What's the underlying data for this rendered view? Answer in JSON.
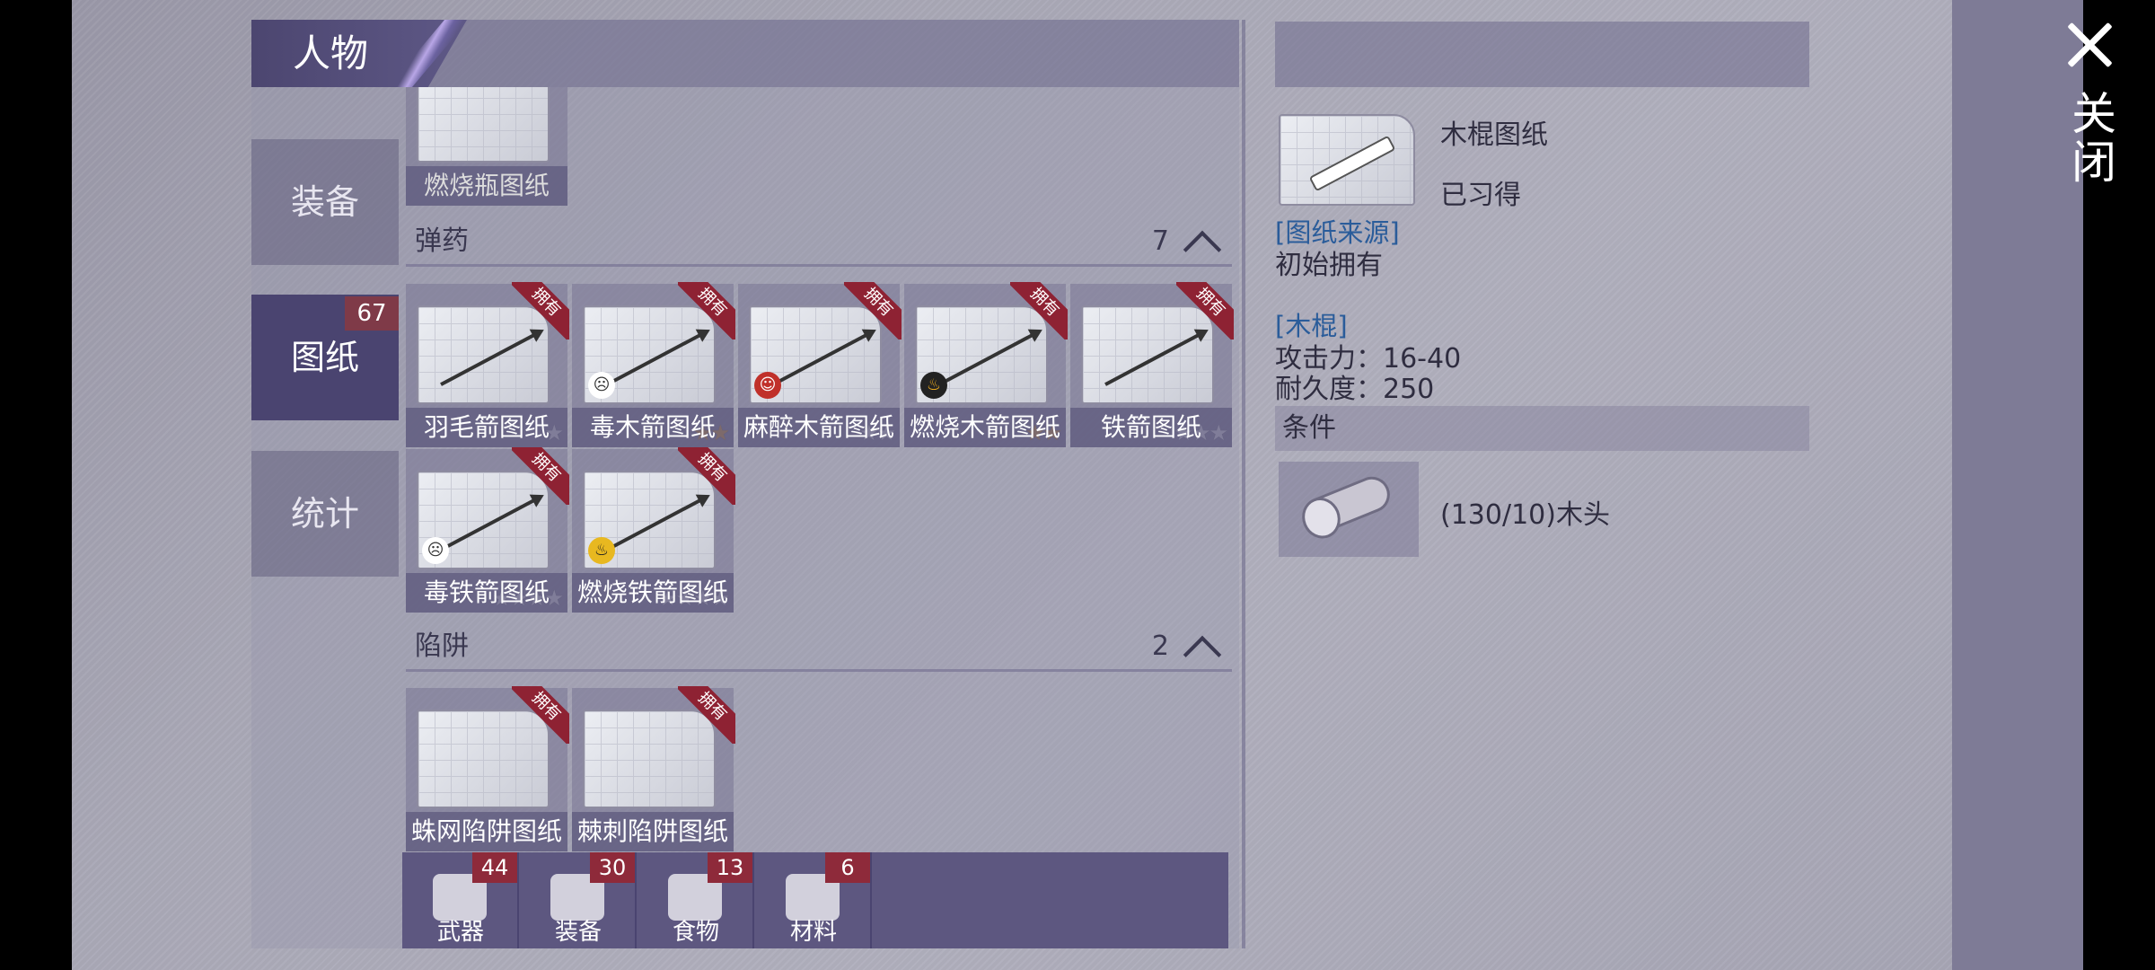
{
  "header": {
    "title": "人物"
  },
  "close": {
    "label": "关闭"
  },
  "side_tabs": [
    {
      "label": "装备"
    },
    {
      "label": "图纸",
      "badge": "67"
    },
    {
      "label": "统计"
    }
  ],
  "top_item": {
    "label": "燃烧瓶图纸"
  },
  "sections": [
    {
      "title": "弹药",
      "count": "7",
      "items": [
        {
          "label": "羽毛箭图纸",
          "owned": "拥有",
          "stars": "★"
        },
        {
          "label": "毒木箭图纸",
          "owned": "拥有",
          "stars": "★★"
        },
        {
          "label": "麻醉木箭图纸",
          "owned": "拥有",
          "stars": "★★"
        },
        {
          "label": "燃烧木箭图纸",
          "owned": "拥有",
          "stars": "★★"
        },
        {
          "label": "铁箭图纸",
          "owned": "拥有",
          "stars": "★★★"
        },
        {
          "label": "毒铁箭图纸",
          "owned": "拥有",
          "stars": "★★★★"
        },
        {
          "label": "燃烧铁箭图纸",
          "owned": "拥有",
          "stars": "★★★★"
        }
      ]
    },
    {
      "title": "陷阱",
      "count": "2",
      "items": [
        {
          "label": "蛛网陷阱图纸",
          "owned": "拥有"
        },
        {
          "label": "棘刺陷阱图纸",
          "owned": "拥有"
        }
      ]
    }
  ],
  "bottom_tabs": [
    {
      "label": "武器",
      "badge": "44"
    },
    {
      "label": "装备",
      "badge": "30"
    },
    {
      "label": "食物",
      "badge": "13"
    },
    {
      "label": "材料",
      "badge": "6"
    }
  ],
  "detail": {
    "name": "木棍图纸",
    "status": "已习得",
    "source_title": "[图纸来源]",
    "source_text": "初始拥有",
    "item_title": "[木棍]",
    "attack": "攻击力：16-40",
    "durability": "耐久度：250",
    "conditions_title": "条件",
    "material": "(130/10)木头"
  }
}
